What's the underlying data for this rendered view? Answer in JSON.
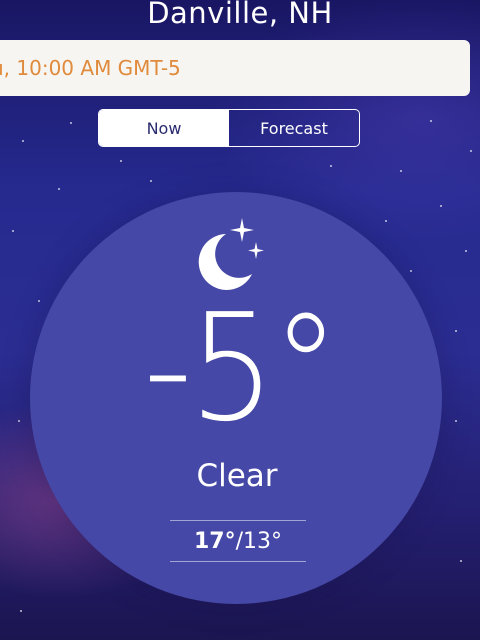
{
  "location": {
    "city": "Danville, NH"
  },
  "time": {
    "text": "u, 10:00 AM GMT-5"
  },
  "tabs": {
    "now_label": "Now",
    "forecast_label": "Forecast",
    "selected": "Now"
  },
  "current": {
    "temperature": "-5°",
    "condition": "Clear",
    "icon": "moon-stars-icon",
    "high": "17°",
    "separator": "/",
    "low": "13°"
  },
  "colors": {
    "background": "#262a8f",
    "circle": "#4548a6",
    "time_text": "#e08a3c",
    "bar": "#f7f5f2"
  }
}
